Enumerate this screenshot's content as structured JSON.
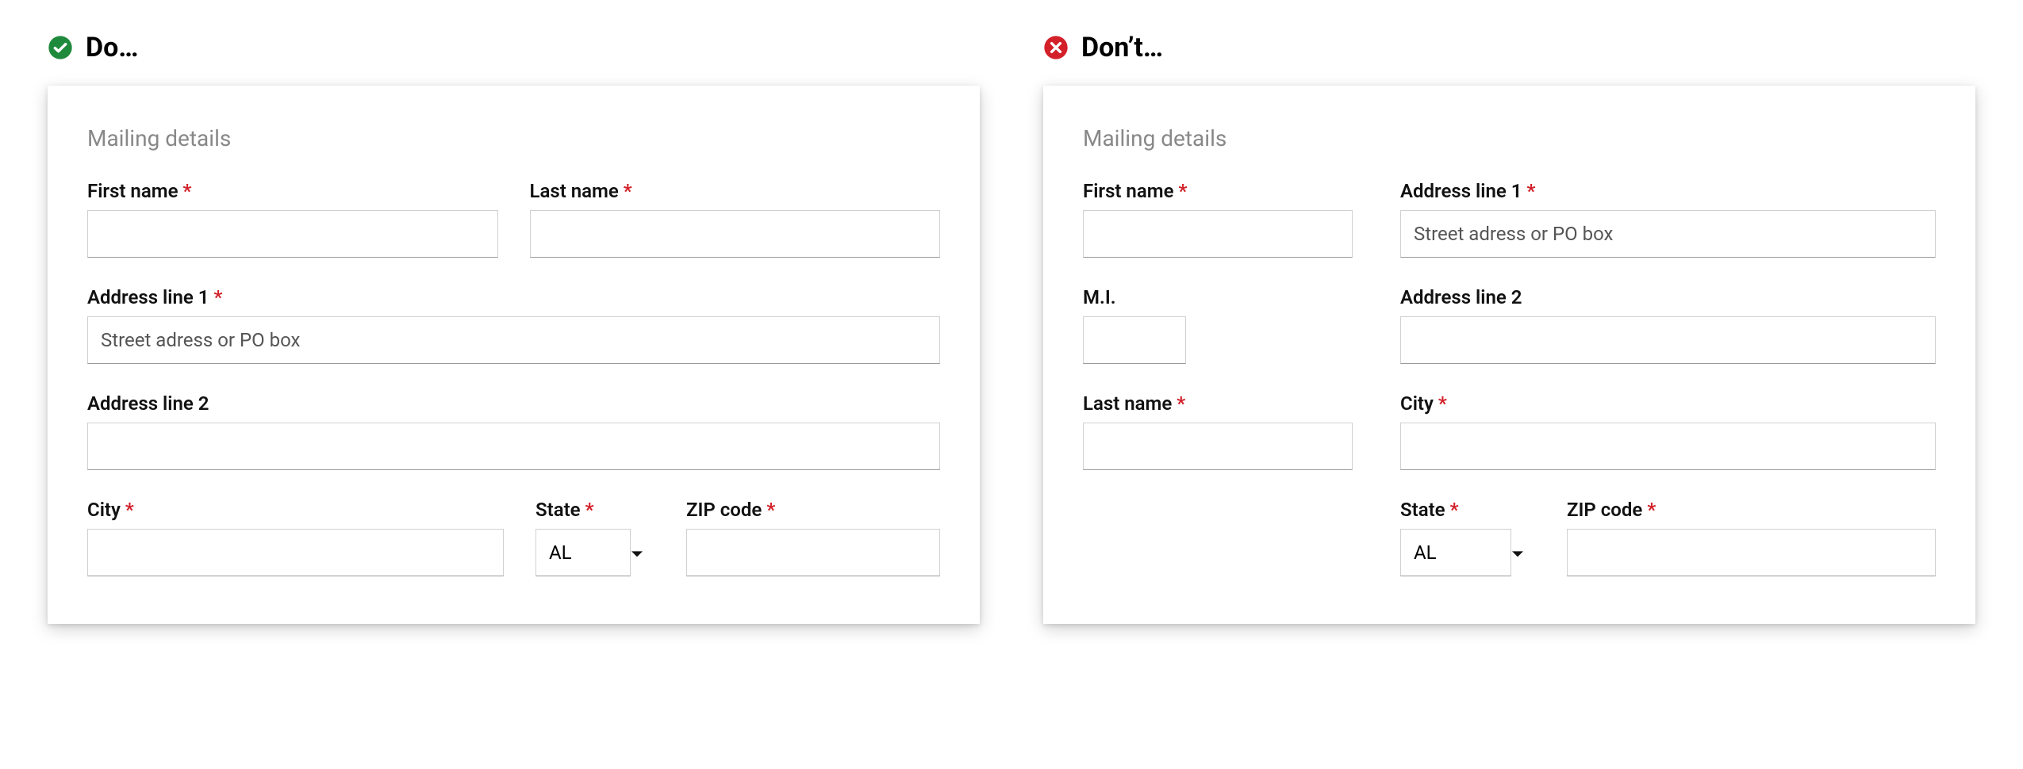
{
  "do": {
    "header": "Do…",
    "section_title": "Mailing details",
    "fields": {
      "first_name": {
        "label": "First name",
        "required": "*"
      },
      "last_name": {
        "label": "Last name",
        "required": "*"
      },
      "addr1": {
        "label": "Address line 1",
        "required": "*",
        "placeholder": "Street adress or PO box"
      },
      "addr2": {
        "label": "Address line 2"
      },
      "city": {
        "label": "City",
        "required": "*"
      },
      "state": {
        "label": "State",
        "required": "*",
        "value": "AL"
      },
      "zip": {
        "label": "ZIP code",
        "required": "*"
      }
    }
  },
  "dont": {
    "header": "Don’t…",
    "section_title": "Mailing details",
    "fields": {
      "first_name": {
        "label": "First name",
        "required": "*"
      },
      "mi": {
        "label": "M.I."
      },
      "last_name": {
        "label": "Last name",
        "required": "*"
      },
      "addr1": {
        "label": "Address line 1",
        "required": "*",
        "placeholder": "Street adress or PO box"
      },
      "addr2": {
        "label": "Address line 2"
      },
      "city": {
        "label": "City",
        "required": "*"
      },
      "state": {
        "label": "State",
        "required": "*",
        "value": "AL"
      },
      "zip": {
        "label": "ZIP code",
        "required": "*"
      }
    }
  },
  "colors": {
    "do_icon": "#228B22",
    "dont_icon": "#d32029"
  }
}
